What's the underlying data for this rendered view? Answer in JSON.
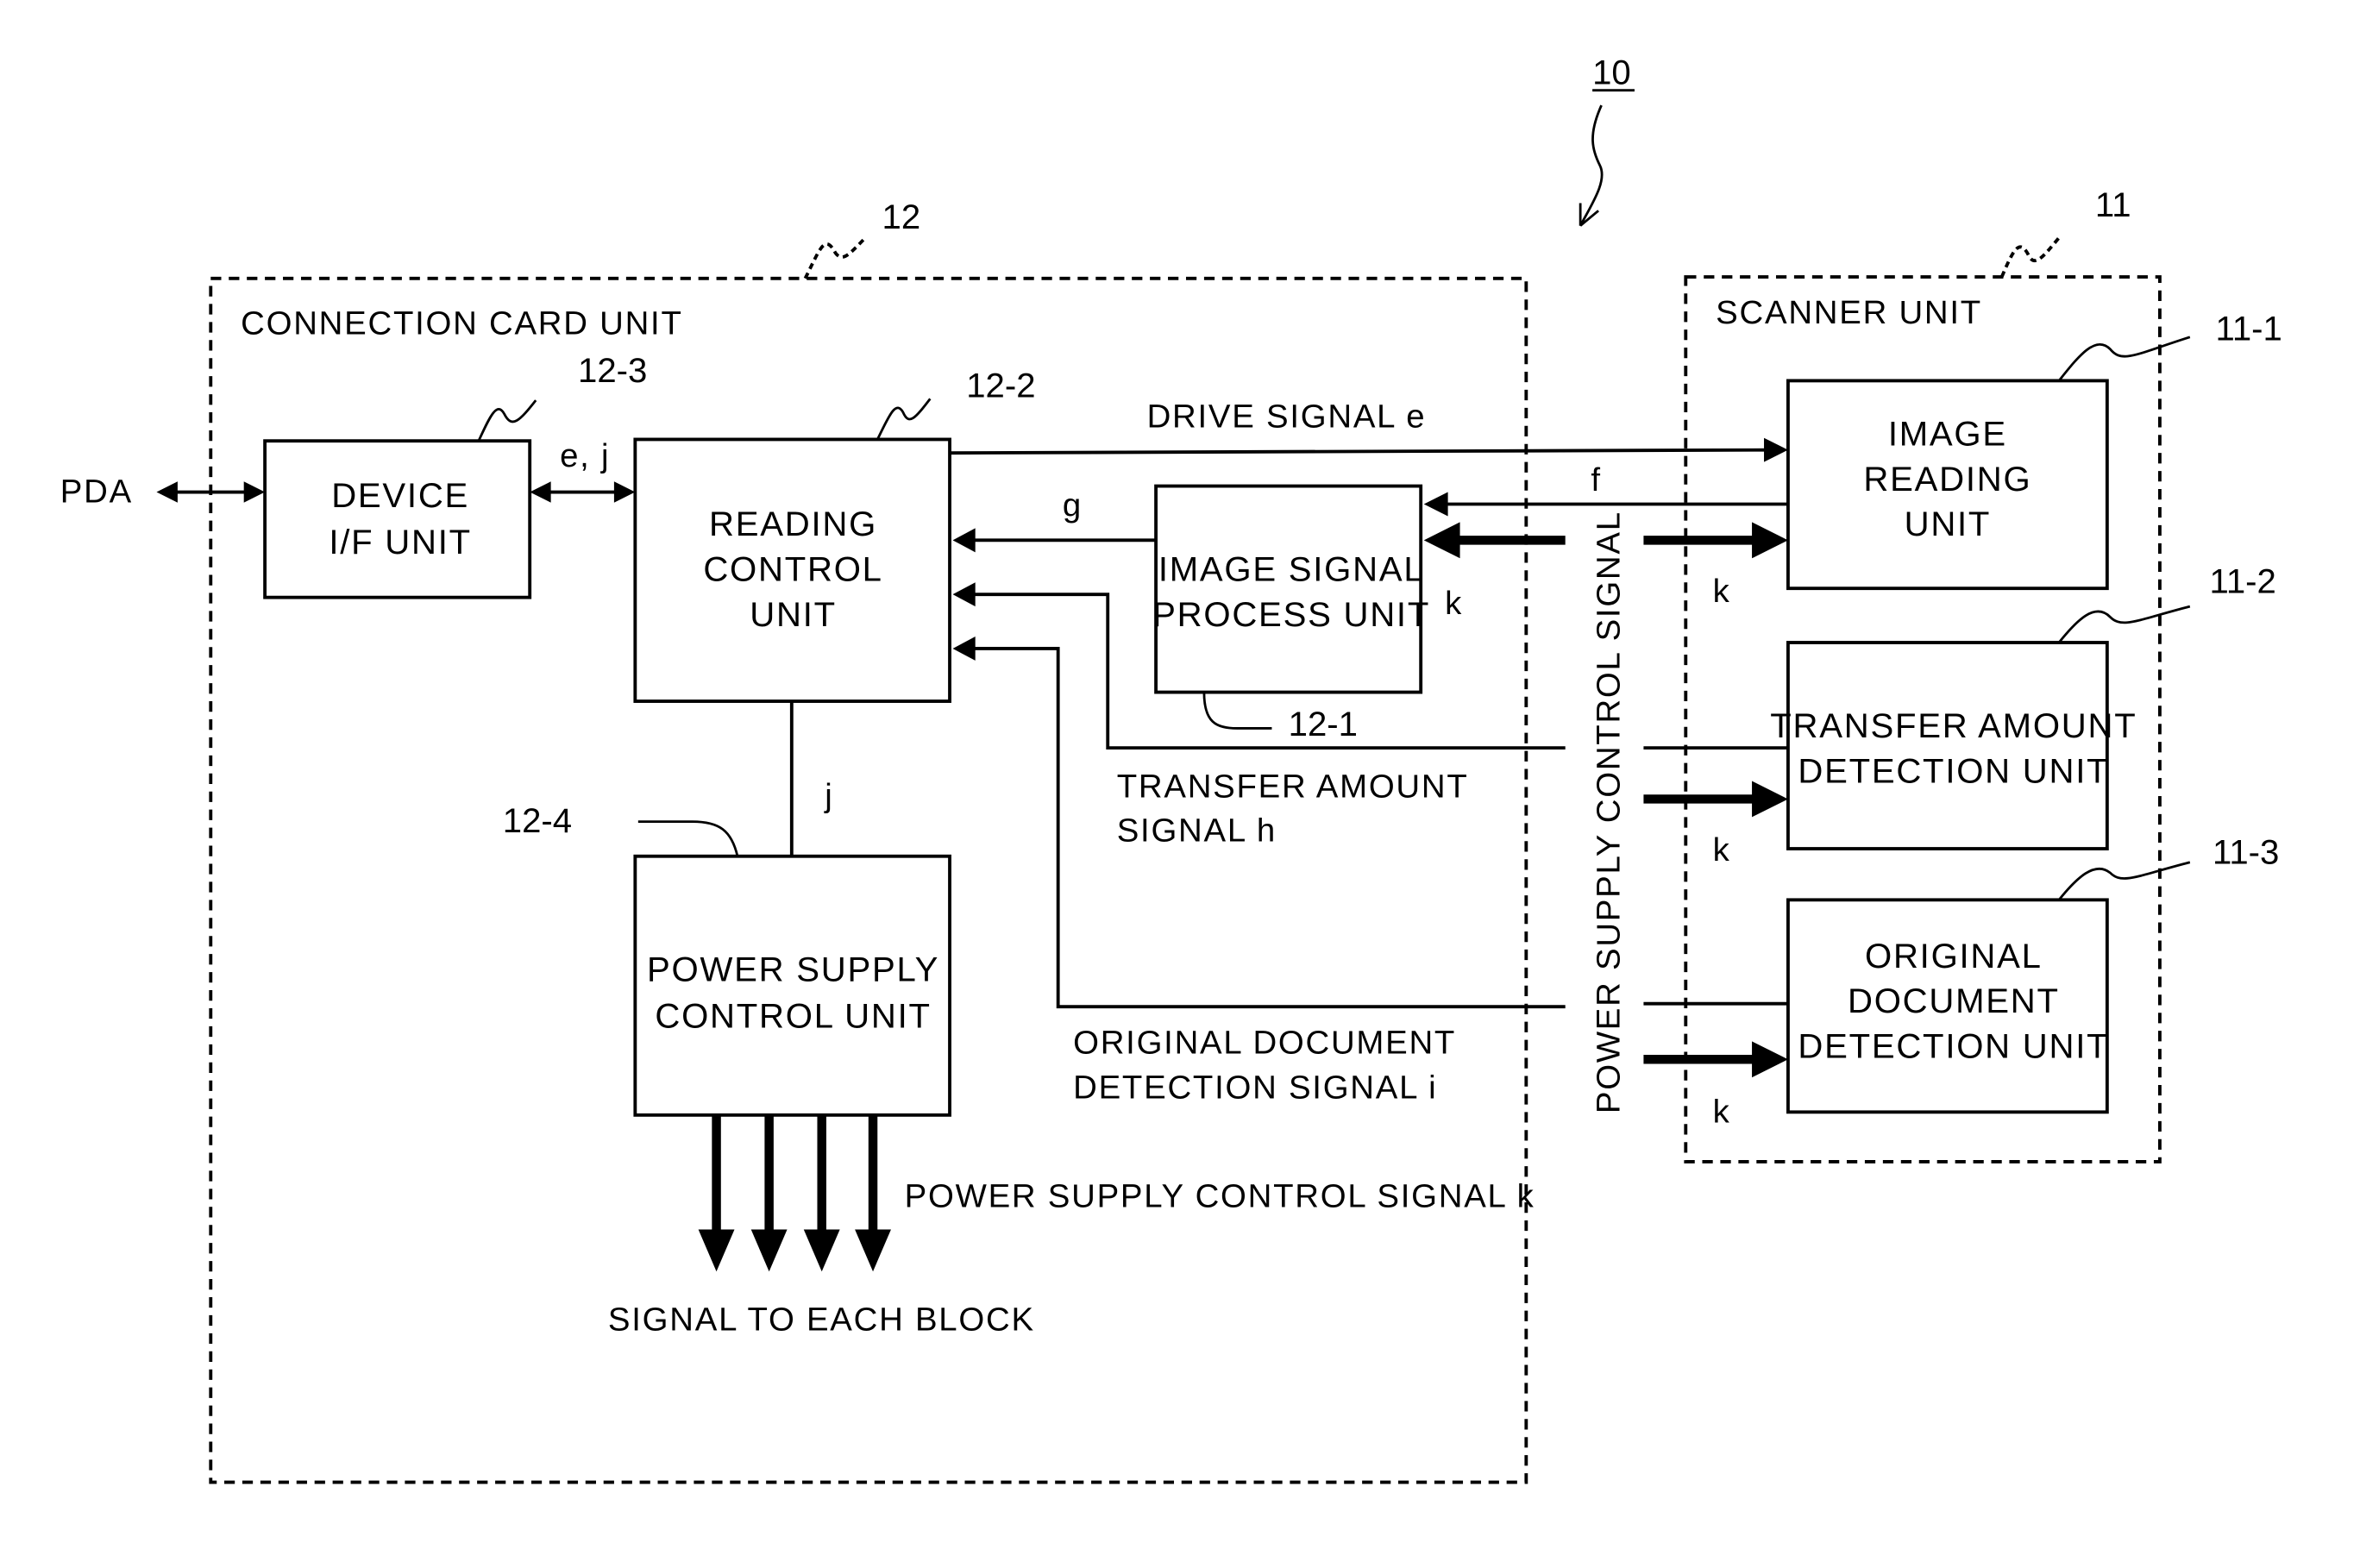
{
  "figure": {
    "ref": "10",
    "groups": {
      "connection_card": {
        "ref": "12",
        "title": "CONNECTION CARD UNIT"
      },
      "scanner": {
        "ref": "11",
        "title": "SCANNER UNIT"
      }
    },
    "external": {
      "pda": "PDA"
    },
    "blocks": {
      "device_if": {
        "ref": "12-3",
        "lines": [
          "DEVICE",
          "I/F UNIT"
        ]
      },
      "reading_control": {
        "ref": "12-2",
        "lines": [
          "READING",
          "CONTROL",
          "UNIT"
        ]
      },
      "image_signal_process": {
        "ref": "12-1",
        "lines": [
          "IMAGE SIGNAL",
          "PROCESS UNIT"
        ]
      },
      "power_supply_control": {
        "ref": "12-4",
        "lines": [
          "POWER SUPPLY",
          "CONTROL UNIT"
        ]
      },
      "image_reading": {
        "ref": "11-1",
        "lines": [
          "IMAGE",
          "READING",
          "UNIT"
        ]
      },
      "transfer_amount_detection": {
        "ref": "11-2",
        "lines": [
          "TRANSFER AMOUNT",
          "DETECTION UNIT"
        ]
      },
      "original_document_detection": {
        "ref": "11-3",
        "lines": [
          "ORIGINAL",
          "DOCUMENT",
          "DETECTION UNIT"
        ]
      }
    },
    "signals": {
      "ej": "e, j",
      "drive": "DRIVE SIGNAL e",
      "f": "f",
      "g": "g",
      "k": "k",
      "j": "j",
      "transfer_amount": [
        "TRANSFER AMOUNT",
        "SIGNAL h"
      ],
      "original_document": [
        "ORIGINAL DOCUMENT",
        "DETECTION SIGNAL i"
      ],
      "power_supply_vertical": "POWER SUPPLY CONTROL SIGNAL",
      "power_supply_k": "POWER SUPPLY CONTROL SIGNAL k",
      "to_each_block": "SIGNAL TO EACH BLOCK"
    }
  }
}
